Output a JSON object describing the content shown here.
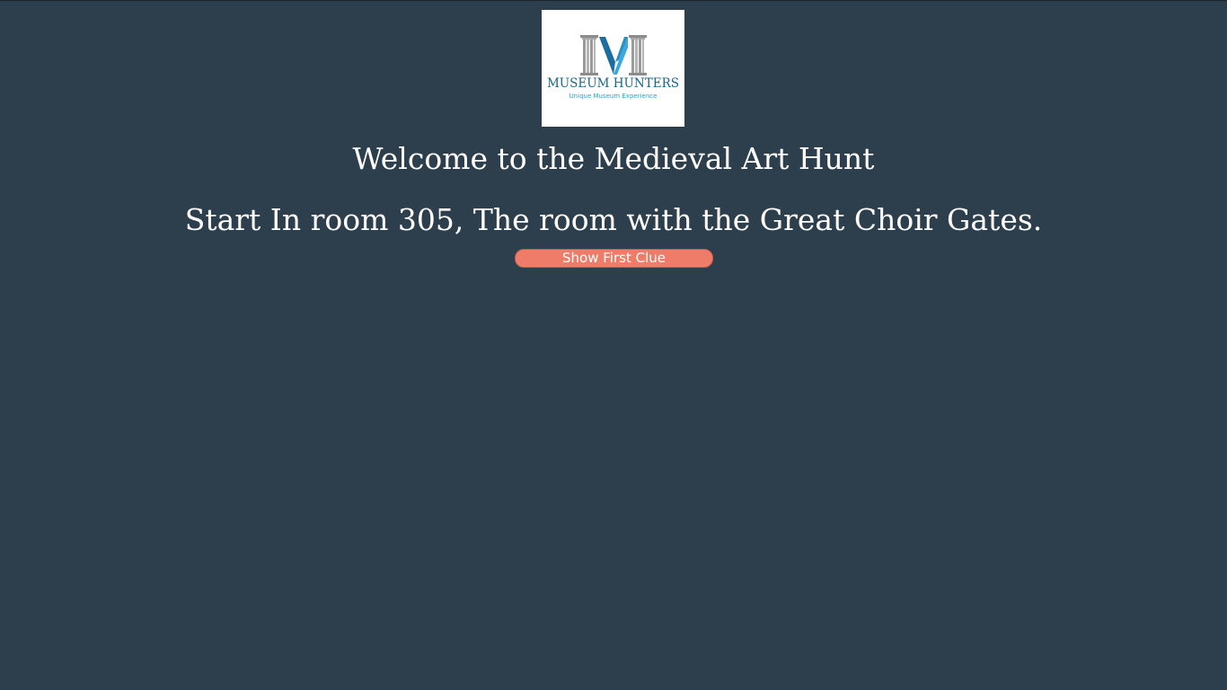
{
  "logo": {
    "title": "MUSEUM HUNTERS",
    "tagline": "Unique Museum Experience",
    "icon": "museum-pillars-m-icon",
    "colors": {
      "pillar": "#9a9a9a",
      "m_dark": "#1a6fa0",
      "m_light": "#35a9e0",
      "text": "#16668c"
    }
  },
  "welcome_heading": "Welcome to the Medieval Art Hunt",
  "start_instruction": "Start In room 305, The room with the Great Choir Gates.",
  "buttons": {
    "show_first_clue": "Show First Clue"
  },
  "colors": {
    "background": "#2d3e4c",
    "button": "#ee7c68",
    "text": "#ffffff"
  }
}
